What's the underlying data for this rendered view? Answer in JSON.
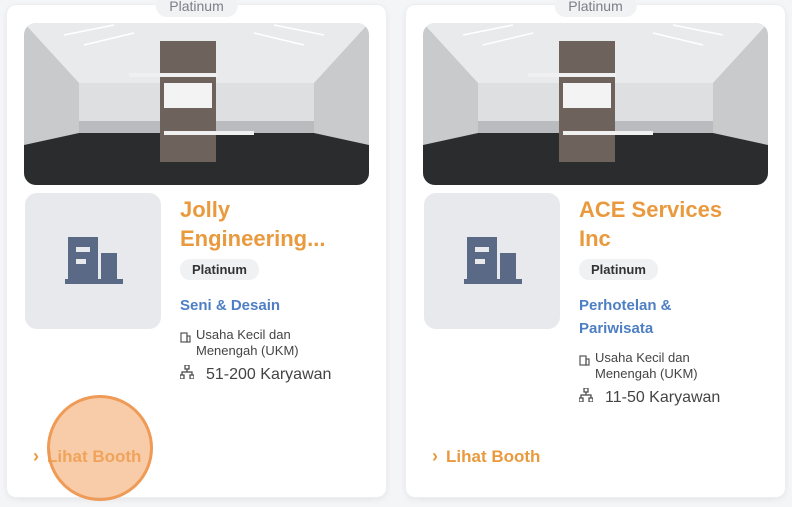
{
  "colors": {
    "accent": "#ea9a3e",
    "industry": "#4e7fc4",
    "click_marker": "#f3aa6e"
  },
  "cards": [
    {
      "tier_label": "Platinum",
      "name": "Jolly Engineering...",
      "badge": "Platinum",
      "industry": "Seni & Desain",
      "company_size": "Usaha Kecil dan Menengah (UKM)",
      "employees": "51-200 Karyawan",
      "view_label": "Lihat Booth",
      "logo_icon": "building-icon"
    },
    {
      "tier_label": "Platinum",
      "name": "ACE Services Inc",
      "badge": "Platinum",
      "industry": "Perhotelan & Pariwisata",
      "company_size": "Usaha Kecil dan Menengah (UKM)",
      "employees": "11-50 Karyawan",
      "view_label": "Lihat Booth",
      "logo_icon": "building-icon"
    }
  ]
}
